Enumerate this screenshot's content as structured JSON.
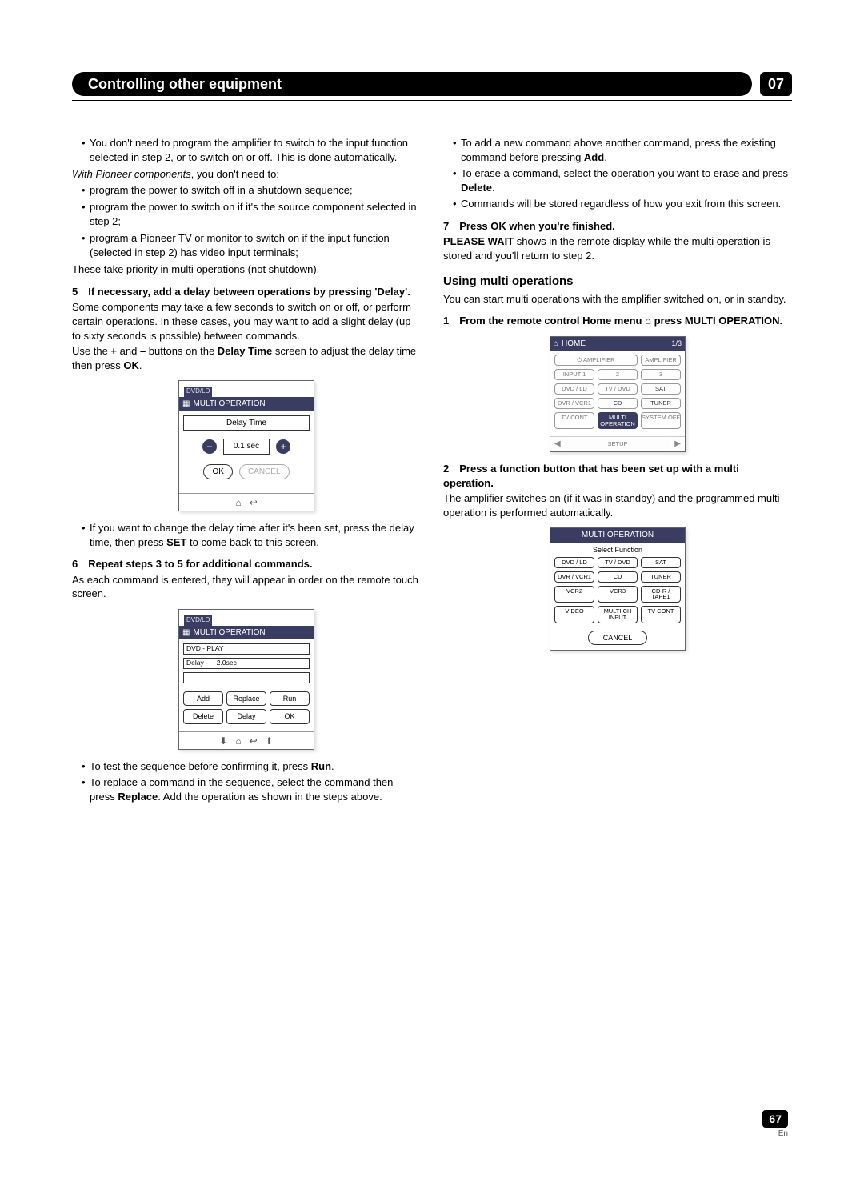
{
  "header": {
    "title": "Controlling other equipment",
    "chapter_num": "07"
  },
  "colA": {
    "b1": "You don't need to program the amplifier to switch to the input function selected in step 2, or to switch on or off. This is done automatically.",
    "italic_lead": "With Pioneer components",
    "italic_rest": ", you don't need to:",
    "b2": "program the power to switch off in a shutdown sequence;",
    "b3": "program the power to switch on if it's the source component selected in step 2;",
    "b4": "program a Pioneer TV or monitor to switch on if the input function (selected in step 2) has video input terminals;",
    "priority": "These take priority in multi operations (not shutdown).",
    "step5_head": "5 If necessary, add a delay between operations by pressing 'Delay'.",
    "step5_p1": "Some components may take a few seconds to switch on or off, or perform certain operations. In these cases, you may want to add a slight delay (up to sixty seconds is possible) between commands.",
    "step5_p2_a": "Use the ",
    "step5_plus": "+",
    "step5_p2_b": " and ",
    "step5_minus": "–",
    "step5_p2_c": " buttons on the ",
    "step5_bold1": "Delay Time",
    "step5_p2_d": " screen to adjust the delay time then press ",
    "step5_bold2": "OK",
    "step5_p2_e": ".",
    "delay_screen": {
      "tab": "DVD/LD",
      "title": "MULTI OPERATION",
      "label": "Delay Time",
      "value": "0.1 sec",
      "ok": "OK",
      "cancel": "CANCEL"
    },
    "after_delay_a": "If you want to change the delay time after it's been set, press the delay time, then press ",
    "after_delay_bold": "SET",
    "after_delay_b": " to come back to this screen.",
    "step6_head": "6 Repeat steps 3 to 5 for additional commands.",
    "step6_p": "As each command is entered, they will appear in order on the remote touch screen.",
    "list_screen": {
      "tab": "DVD/LD",
      "title": "MULTI OPERATION",
      "line1": "DVD - PLAY",
      "line2": "Delay -  2.0sec",
      "add": "Add",
      "replace": "Replace",
      "run": "Run",
      "delete": "Delete",
      "delay": "Delay",
      "ok": "OK"
    },
    "test_a": "To test the sequence before confirming it, press ",
    "test_bold": "Run",
    "test_b": ".",
    "replace_a": "To replace a command in the sequence, select the command then press ",
    "replace_bold": "Replace",
    "replace_b": ". Add the operation as shown in the steps above."
  },
  "colB": {
    "add_a": "To add a new command above another command, press the existing command before pressing ",
    "add_bold": "Add",
    "add_b": ".",
    "erase_a": "To erase a command, select the operation you want to erase and press ",
    "erase_bold": "Delete",
    "erase_b": ".",
    "stored": "Commands will be stored regardless of how you exit from this screen.",
    "step7_head": "7 Press OK when you're finished.",
    "step7_bold": "PLEASE WAIT",
    "step7_rest": " shows in the remote display while the multi operation is stored and you'll return to step 2.",
    "sub_using": "Using multi operations",
    "using_p": "You can start multi operations with the amplifier switched on, or in standby.",
    "step1_a": "1 From the remote control Home menu ",
    "step1_b": " press MULTI OPERATION.",
    "home_screen": {
      "title": "HOME",
      "page": "1/3",
      "cells": [
        "⏻ AMPLIFIER",
        "AMPLIFIER",
        "INPUT 1",
        "2",
        "3",
        "DVD / LD",
        "TV / DVD",
        "SAT",
        "DVR / VCR1",
        "CD",
        "TUNER",
        "TV CONT",
        "MULTI OPERATION",
        "SYSTEM OFF"
      ],
      "setup": "SETUP"
    },
    "step2_head": "2 Press a function button that has been set up with a multi operation.",
    "step2_p": "The amplifier switches on (if it was in standby) and the programmed multi operation is performed automatically.",
    "select_screen": {
      "title": "MULTI OPERATION",
      "sub": "Select Function",
      "btns": [
        "DVD / LD",
        "TV / DVD",
        "SAT",
        "DVR / VCR1",
        "CD",
        "TUNER",
        "VCR2",
        "VCR3",
        "CD-R / TAPE1",
        "VIDEO",
        "MULTI CH INPUT",
        "TV CONT"
      ],
      "cancel": "CANCEL"
    }
  },
  "footer": {
    "page": "67",
    "lang": "En"
  }
}
